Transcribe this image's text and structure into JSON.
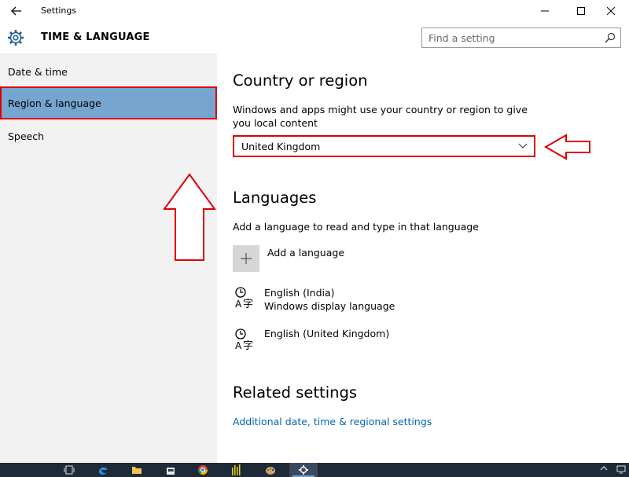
{
  "titlebar": {
    "title": "Settings"
  },
  "header": {
    "app_title": "TIME & LANGUAGE",
    "search_placeholder": "Find a setting"
  },
  "sidebar": {
    "items": [
      {
        "label": "Date & time",
        "selected": false
      },
      {
        "label": "Region & language",
        "selected": true
      },
      {
        "label": "Speech",
        "selected": false
      }
    ]
  },
  "main": {
    "country_heading": "Country or region",
    "country_desc": "Windows and apps might use your country or region to give you local content",
    "country_selected": "United Kingdom",
    "languages_heading": "Languages",
    "languages_desc": "Add a language to read and type in that language",
    "add_language_label": "Add a language",
    "languages": [
      {
        "name": "English (India)",
        "sub": "Windows display language"
      },
      {
        "name": "English (United Kingdom)",
        "sub": ""
      }
    ],
    "related_heading": "Related settings",
    "related_link": "Additional date, time & regional settings"
  },
  "colors": {
    "selected_nav": "#76a5cf",
    "highlight_red": "#e00000",
    "link": "#0066b4",
    "sidebar_bg": "#f2f2f2",
    "taskbar_bg": "#1e2a38"
  },
  "icons": {
    "back": "back-arrow-icon",
    "settings": "gear-icon",
    "search": "search-icon",
    "dropdown": "chevron-down-icon",
    "add": "plus-icon",
    "language": "language-icon"
  }
}
